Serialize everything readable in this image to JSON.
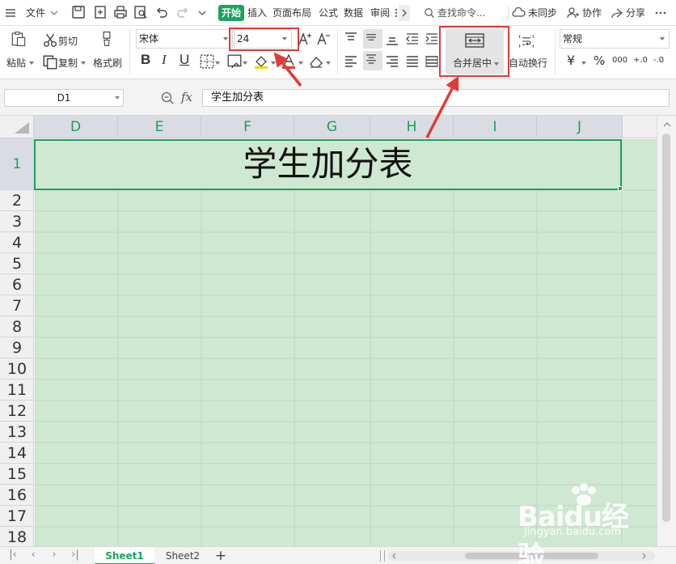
{
  "menubar": {
    "file_label": "文件",
    "home_tab": "开始",
    "tabs": [
      "插入",
      "页面布局",
      "公式",
      "数据",
      "审阅"
    ],
    "search_placeholder": "查找命令...",
    "sync_label": "未同步",
    "collab_label": "协作",
    "share_label": "分享"
  },
  "ribbon": {
    "paste_label": "粘贴",
    "cut_label": "剪切",
    "copy_label": "复制",
    "format_painter_label": "格式刷",
    "font_name": "宋体",
    "font_size": "24",
    "merge_center_label": "合并居中",
    "wrap_text_label": "自动换行",
    "number_format": "常规",
    "bold_glyph": "B",
    "italic_glyph": "I",
    "underline_glyph": "U",
    "currency_glyph": "¥",
    "percent_glyph": "%",
    "thousands_glyph": "000",
    "dec_inc_glyph": "+.0",
    "dec_dec_glyph": "-.0"
  },
  "formulabar": {
    "name_box": "D1",
    "fx_label": "fx",
    "formula": "学生加分表"
  },
  "grid": {
    "columns": [
      "D",
      "E",
      "F",
      "G",
      "H",
      "I",
      "J"
    ],
    "rows": [
      "1",
      "2",
      "3",
      "4",
      "5",
      "6",
      "7",
      "8",
      "9",
      "10",
      "11",
      "12",
      "13",
      "14",
      "15",
      "16",
      "17",
      "18"
    ],
    "merged_cell_text": "学生加分表"
  },
  "sheets": {
    "tabs": [
      "Sheet1",
      "Sheet2"
    ],
    "active": "Sheet1",
    "add_label": "+"
  },
  "watermark": {
    "brand": "Baidu经验",
    "url": "jingyan.baidu.com"
  },
  "colors": {
    "accent_green": "#1aa35f",
    "cell_fill": "#cfe8d2",
    "annotation_red": "#e53935"
  }
}
